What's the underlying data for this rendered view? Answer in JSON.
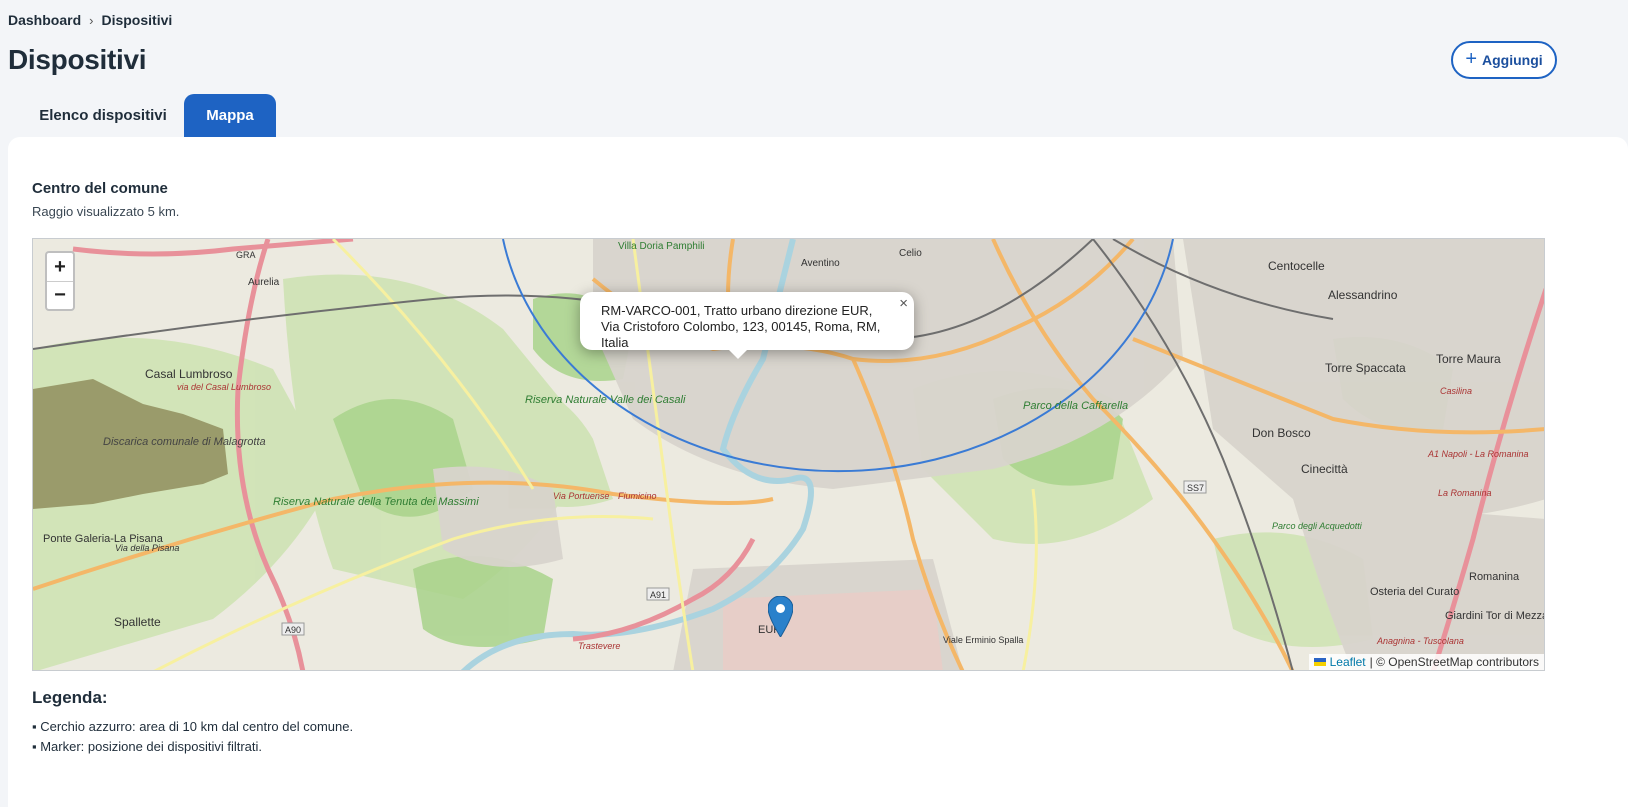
{
  "breadcrumb": {
    "home": "Dashboard",
    "separator": "›",
    "current": "Dispositivi"
  },
  "page": {
    "title": "Dispositivi",
    "add_label": "Aggiungi"
  },
  "tabs": [
    {
      "label": "Elenco dispositivi",
      "active": false
    },
    {
      "label": "Mappa",
      "active": true
    }
  ],
  "section": {
    "title": "Centro del comune",
    "subtitle": "Raggio visualizzato 5 km."
  },
  "map": {
    "zoom_in": "+",
    "zoom_out": "−",
    "popup_text": "RM-VARCO-001, Tratto urbano direzione EUR, Via Cristoforo Colombo, 123, 00145, Roma, RM, Italia",
    "popup_close": "×",
    "attribution_leaflet": "Leaflet",
    "attribution_osm": "| © OpenStreetMap contributors",
    "labels": {
      "villa_doria": "Villa Doria Pamphili",
      "aventino": "Aventino",
      "celio": "Celio",
      "centocelle": "Centocelle",
      "alessandrino": "Alessandrino",
      "casal_lumbroso": "Casal Lumbroso",
      "via_casal_lumbroso": "via del Casal Lumbroso",
      "torre_maura": "Torre Maura",
      "torre_spaccata": "Torre Spaccata",
      "riserva_valle_casali": "Riserva Naturale Valle dei Casali",
      "parco_caffarella": "Parco della Caffarella",
      "discarica": "Discarica comunale di Malagrotta",
      "don_bosco": "Don Bosco",
      "cinecitta": "Cinecittà",
      "via_portuense": "Via Portuense",
      "fiumicino": "Fiumicino",
      "riserva_tenuta": "Riserva Naturale della Tenuta dei Massimi",
      "ponte_galeria": "Ponte Galeria-La Pisana",
      "via_pisana": "Via della Pisana",
      "parco_acquedotti": "Parco degli Acquedotti",
      "osteria_curato": "Osteria del Curato",
      "romanina": "Romanina",
      "giardini": "Giardini Tor di Mezzavia",
      "spallette": "Spallette",
      "trastevere": "Trastevere",
      "eur": "EUR",
      "a90": "A90",
      "a91": "A91",
      "ss7": "SS7",
      "aurelia": "Aurelia",
      "gra": "GRA",
      "viale_erminio": "Viale Erminio Spalla",
      "casilina": "Casilina",
      "via_anagnina": "Anagnina - Tuscolana",
      "a1": "A1 Napoli - La Romanina",
      "la_romanina": "La Romanina"
    }
  },
  "legend": {
    "title": "Legenda:",
    "items": [
      "▪ Cerchio azzurro: area di 10 km dal centro del comune.",
      "▪ Marker: posizione dei dispositivi filtrati."
    ]
  },
  "colors": {
    "accent": "#1e63c3",
    "circle": "#3a7bd5",
    "marker": "#2a81cb"
  }
}
